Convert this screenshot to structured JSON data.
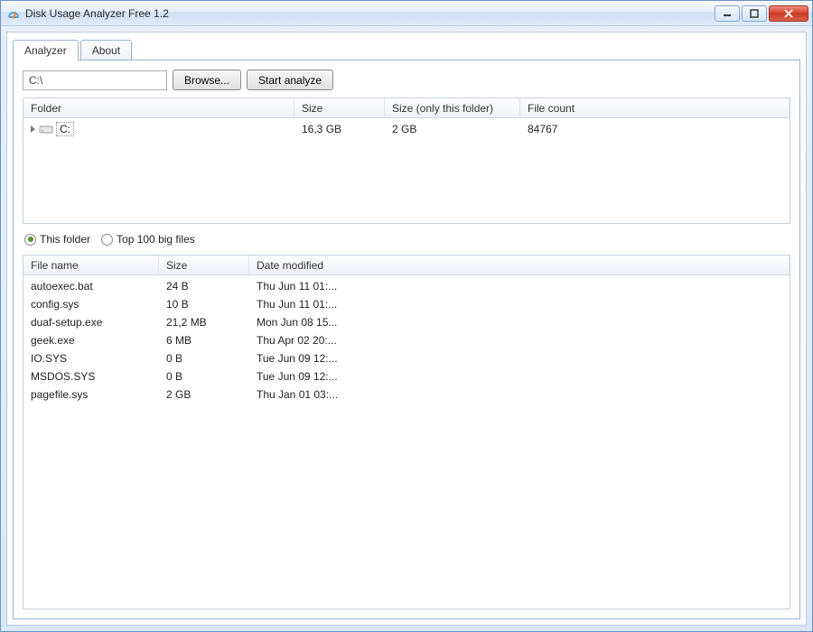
{
  "title": "Disk Usage Analyzer Free 1.2",
  "tabs": {
    "analyzer": "Analyzer",
    "about": "About"
  },
  "path": "C:\\",
  "buttons": {
    "browse": "Browse...",
    "start": "Start analyze"
  },
  "top_columns": {
    "folder": "Folder",
    "size": "Size",
    "size_only": "Size (only this folder)",
    "file_count": "File count"
  },
  "top_row": {
    "name": "C:",
    "size": "16,3 GB",
    "size_only": "2 GB",
    "file_count": "84767"
  },
  "view_mode": {
    "this_folder": "This folder",
    "top100": "Top 100 big files"
  },
  "bottom_columns": {
    "filename": "File name",
    "size": "Size",
    "date": "Date modified"
  },
  "files": [
    {
      "name": "autoexec.bat",
      "size": "24 B",
      "date": "Thu Jun 11 01:..."
    },
    {
      "name": "config.sys",
      "size": "10 B",
      "date": "Thu Jun 11 01:..."
    },
    {
      "name": "duaf-setup.exe",
      "size": "21,2 MB",
      "date": "Mon Jun 08 15..."
    },
    {
      "name": "geek.exe",
      "size": "6 MB",
      "date": "Thu Apr 02 20:..."
    },
    {
      "name": "IO.SYS",
      "size": "0 B",
      "date": "Tue Jun 09 12:..."
    },
    {
      "name": "MSDOS.SYS",
      "size": "0 B",
      "date": "Tue Jun 09 12:..."
    },
    {
      "name": "pagefile.sys",
      "size": "2 GB",
      "date": "Thu Jan 01 03:..."
    }
  ]
}
